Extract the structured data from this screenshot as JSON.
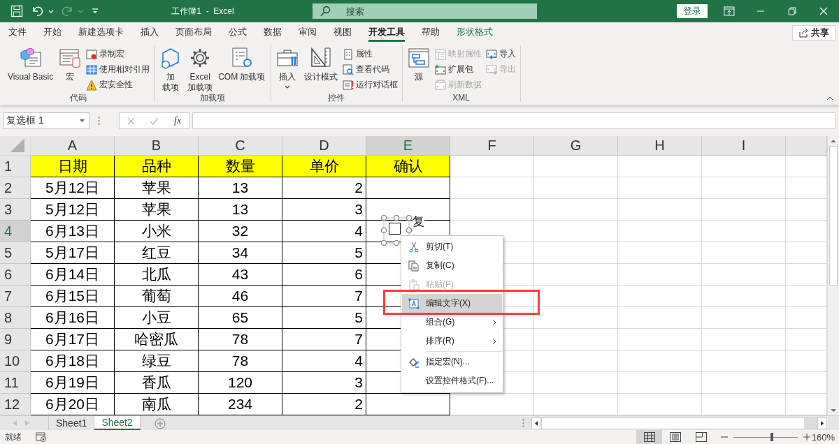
{
  "title_bar": {
    "quick_access": [
      {
        "kind": "save",
        "disabled": false
      },
      {
        "kind": "undo",
        "disabled": false
      },
      {
        "kind": "redo",
        "disabled": true
      },
      {
        "kind": "customize",
        "disabled": false
      }
    ],
    "title": "工作簿1  -  Excel",
    "search": {
      "placeholder": "搜索"
    },
    "sign_in": "登录"
  },
  "ribbon_tabs": [
    {
      "label": "文件",
      "selected": false,
      "kind": "normal"
    },
    {
      "label": "开始",
      "selected": false,
      "kind": "normal"
    },
    {
      "label": "新建选项卡",
      "selected": false,
      "kind": "normal"
    },
    {
      "label": "插入",
      "selected": false,
      "kind": "normal"
    },
    {
      "label": "页面布局",
      "selected": false,
      "kind": "normal"
    },
    {
      "label": "公式",
      "selected": false,
      "kind": "normal"
    },
    {
      "label": "数据",
      "selected": false,
      "kind": "normal"
    },
    {
      "label": "审阅",
      "selected": false,
      "kind": "normal"
    },
    {
      "label": "视图",
      "selected": false,
      "kind": "normal"
    },
    {
      "label": "开发工具",
      "selected": true,
      "kind": "normal"
    },
    {
      "label": "帮助",
      "selected": false,
      "kind": "normal"
    },
    {
      "label": "形状格式",
      "selected": false,
      "kind": "contextual"
    }
  ],
  "share": "共享",
  "ribbon_groups": [
    {
      "label": "代码",
      "items": [
        {
          "kind": "large",
          "lines": [
            "Visual Basic"
          ]
        },
        {
          "kind": "large",
          "lines": [
            "宏"
          ]
        },
        {
          "kind": "column",
          "items": [
            {
              "label": "录制宏",
              "disabled": false
            },
            {
              "label": "使用相对引用",
              "disabled": false
            },
            {
              "label": "宏安全性",
              "disabled": false
            }
          ]
        }
      ]
    },
    {
      "label": "加载项",
      "items": [
        {
          "kind": "large",
          "lines": [
            "加",
            "载项"
          ]
        },
        {
          "kind": "large",
          "lines": [
            "Excel",
            "加载项"
          ]
        },
        {
          "kind": "large",
          "lines": [
            "COM 加载项"
          ]
        }
      ]
    },
    {
      "label": "控件",
      "items": [
        {
          "kind": "large",
          "lines": [
            "插入"
          ],
          "menu": true
        },
        {
          "kind": "large",
          "lines": [
            "设计模式"
          ]
        },
        {
          "kind": "column",
          "items": [
            {
              "label": "属性",
              "disabled": false
            },
            {
              "label": "查看代码",
              "disabled": false
            },
            {
              "label": "运行对话框",
              "disabled": false
            }
          ]
        }
      ]
    },
    {
      "label": "XML",
      "items": [
        {
          "kind": "large",
          "lines": [
            "源"
          ]
        },
        {
          "kind": "column",
          "items": [
            {
              "label": "映射属性",
              "disabled": true
            },
            {
              "label": "扩展包",
              "disabled": false
            },
            {
              "label": "刷新数据",
              "disabled": true
            }
          ]
        },
        {
          "kind": "column",
          "items": [
            {
              "label": "导入",
              "disabled": false
            },
            {
              "label": "导出",
              "disabled": true
            }
          ]
        }
      ]
    }
  ],
  "formula_bar": {
    "name_box": "复选框 1",
    "function_label": "fx"
  },
  "columns": [
    {
      "label": "A",
      "selected": false
    },
    {
      "label": "B",
      "selected": false
    },
    {
      "label": "C",
      "selected": false
    },
    {
      "label": "D",
      "selected": false
    },
    {
      "label": "E",
      "selected": true
    },
    {
      "label": "F",
      "selected": false
    },
    {
      "label": "G",
      "selected": false
    },
    {
      "label": "H",
      "selected": false
    },
    {
      "label": "I",
      "selected": false
    }
  ],
  "rows": [
    {
      "number": "1",
      "selected": false,
      "highlighted": true,
      "cells": [
        "日期",
        "品种",
        "数量",
        "单价",
        "确认"
      ]
    },
    {
      "number": "2",
      "selected": false,
      "highlighted": false,
      "cells": [
        "5月12日",
        "苹果",
        "13",
        "2"
      ]
    },
    {
      "number": "3",
      "selected": false,
      "highlighted": false,
      "cells": [
        "5月12日",
        "苹果",
        "13",
        "3"
      ]
    },
    {
      "number": "4",
      "selected": true,
      "highlighted": false,
      "cells": [
        "6月13日",
        "小米",
        "32",
        "4"
      ]
    },
    {
      "number": "5",
      "selected": false,
      "highlighted": false,
      "cells": [
        "5月17日",
        "红豆",
        "34",
        "5"
      ]
    },
    {
      "number": "6",
      "selected": false,
      "highlighted": false,
      "cells": [
        "6月14日",
        "北瓜",
        "43",
        "6"
      ]
    },
    {
      "number": "7",
      "selected": false,
      "highlighted": false,
      "cells": [
        "6月15日",
        "葡萄",
        "46",
        "7"
      ]
    },
    {
      "number": "8",
      "selected": false,
      "highlighted": false,
      "cells": [
        "6月16日",
        "小豆",
        "65",
        "5"
      ]
    },
    {
      "number": "9",
      "selected": false,
      "highlighted": false,
      "cells": [
        "6月17日",
        "哈密瓜",
        "78",
        "7"
      ]
    },
    {
      "number": "10",
      "selected": false,
      "highlighted": false,
      "cells": [
        "6月18日",
        "绿豆",
        "78",
        "4"
      ]
    },
    {
      "number": "11",
      "selected": false,
      "highlighted": false,
      "cells": [
        "6月19日",
        "香瓜",
        "120",
        "3"
      ]
    },
    {
      "number": "12",
      "selected": false,
      "highlighted": false,
      "cells": [
        "6月20日",
        "南瓜",
        "234",
        "2"
      ]
    }
  ],
  "checkbox_control": {
    "label": "复",
    "checked": false,
    "selected": true
  },
  "context_menu": [
    {
      "kind": "item",
      "label": "剪切(T)",
      "disabled": false,
      "highlighted": false,
      "submenu": false
    },
    {
      "kind": "item",
      "label": "复制(C)",
      "disabled": false,
      "highlighted": false,
      "submenu": false
    },
    {
      "kind": "item",
      "label": "粘贴(P)",
      "disabled": true,
      "highlighted": false,
      "submenu": false
    },
    {
      "kind": "item",
      "label": "编辑文字(X)",
      "disabled": false,
      "highlighted": true,
      "submenu": false
    },
    {
      "kind": "item",
      "label": "组合(G)",
      "disabled": false,
      "highlighted": false,
      "submenu": true
    },
    {
      "kind": "item",
      "label": "排序(R)",
      "disabled": false,
      "highlighted": false,
      "submenu": true
    },
    {
      "kind": "separator"
    },
    {
      "kind": "item",
      "label": "指定宏(N)...",
      "disabled": false,
      "highlighted": false,
      "submenu": false
    },
    {
      "kind": "item",
      "label": "设置控件格式(F)...",
      "disabled": false,
      "highlighted": false,
      "submenu": false
    }
  ],
  "sheet_tabs": [
    {
      "label": "Sheet1",
      "selected": false
    },
    {
      "label": "Sheet2",
      "selected": true
    }
  ],
  "status_bar": {
    "status": "就绪",
    "views": [
      {
        "kind": "normal",
        "selected": true
      },
      {
        "kind": "page_layout",
        "selected": false
      },
      {
        "kind": "page_break",
        "selected": false
      }
    ],
    "zoom": {
      "level": 0.6,
      "reading": "160%"
    }
  }
}
